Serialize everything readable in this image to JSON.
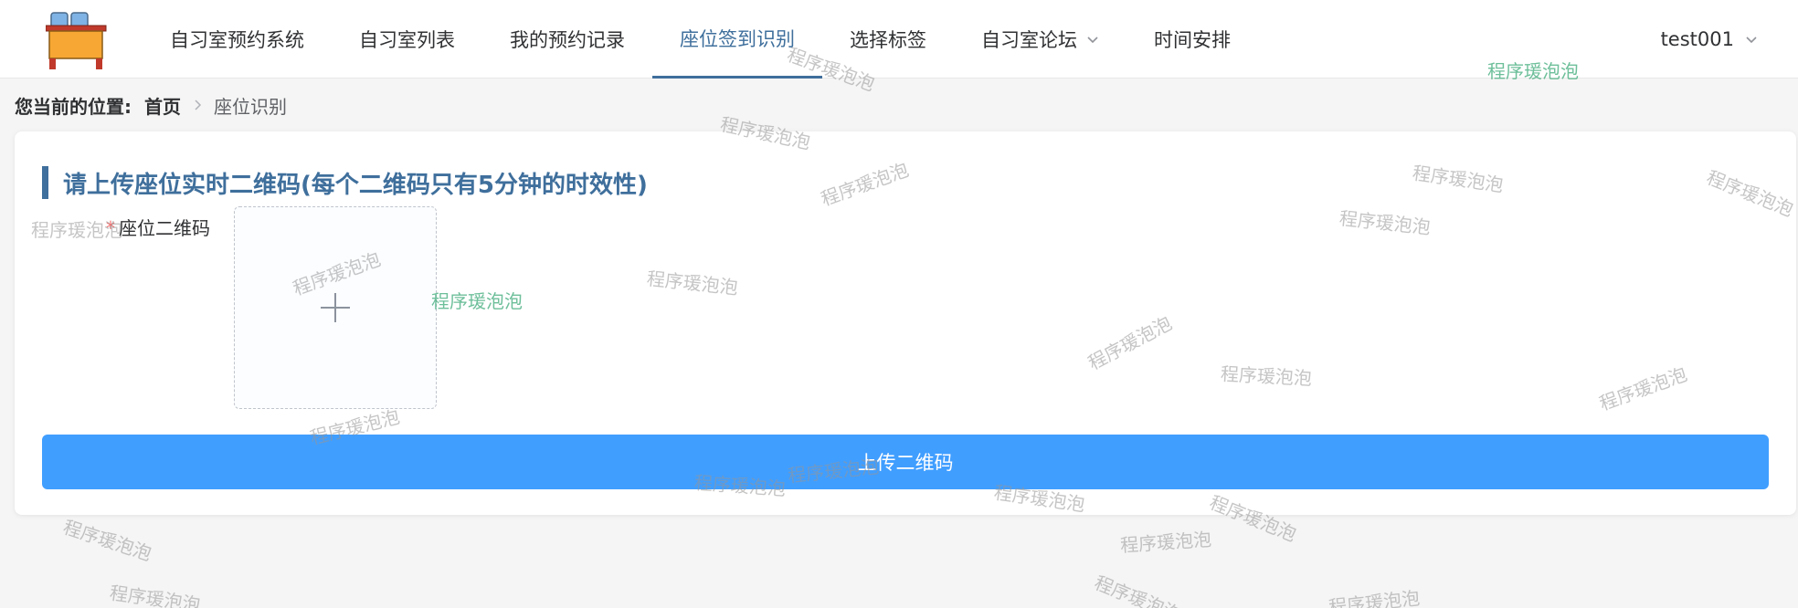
{
  "header": {
    "nav": [
      {
        "label": "自习室预约系统"
      },
      {
        "label": "自习室列表"
      },
      {
        "label": "我的预约记录"
      },
      {
        "label": "座位签到识别"
      },
      {
        "label": "选择标签"
      },
      {
        "label": "自习室论坛"
      },
      {
        "label": "时间安排"
      }
    ],
    "active_index": 3,
    "user": "test001"
  },
  "breadcrumb": {
    "prefix": "您当前的位置:",
    "home": "首页",
    "current": "座位识别"
  },
  "card": {
    "title": "请上传座位实时二维码(每个二维码只有5分钟的时效性)",
    "field_required_mark": "*",
    "field_label": "座位二维码",
    "submit_label": "上传二维码"
  },
  "watermark": {
    "text": "程序瑗泡泡"
  },
  "colors": {
    "accent": "#3f6f9c",
    "primary_button": "#409eff",
    "required": "#f56c6c"
  }
}
